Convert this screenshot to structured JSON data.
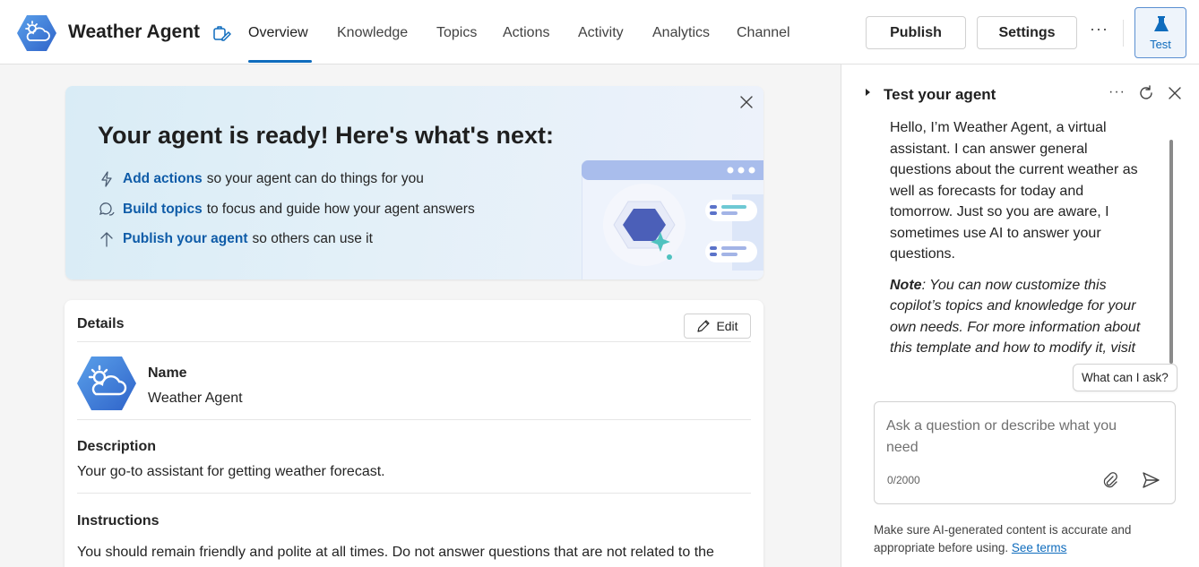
{
  "app": {
    "title": "Weather Agent"
  },
  "nav": {
    "tabs": [
      {
        "label": "Overview",
        "active": true
      },
      {
        "label": "Knowledge"
      },
      {
        "label": "Topics"
      },
      {
        "label": "Actions"
      },
      {
        "label": "Activity"
      },
      {
        "label": "Analytics"
      },
      {
        "label": "Channel"
      }
    ]
  },
  "toolbar": {
    "publish_label": "Publish",
    "settings_label": "Settings",
    "more_label": "···",
    "test_label": "Test"
  },
  "banner": {
    "title": "Your agent is ready! Here's what's next:",
    "items": [
      {
        "icon": "lightning-icon",
        "link": "Add actions",
        "text": "so your agent can do things for you"
      },
      {
        "icon": "chat-bubbles-icon",
        "link": "Build topics",
        "text": "to focus and guide how your agent answers"
      },
      {
        "icon": "arrow-up-icon",
        "link": "Publish your agent",
        "text": "so others can use it"
      }
    ]
  },
  "details": {
    "title": "Details",
    "edit_label": "Edit",
    "name_label": "Name",
    "name_value": "Weather Agent",
    "description_label": "Description",
    "description_value": "Your go-to assistant for getting weather forecast.",
    "instructions_label": "Instructions",
    "instructions_value": "You should remain friendly and polite at all times. Do not answer questions that are not related to the"
  },
  "test_panel": {
    "title": "Test your agent",
    "more_label": "···",
    "greeting": "Hello, I’m Weather Agent, a virtual assistant. I can answer general questions about the current weather as well as forecasts for today and tomorrow. Just so you are aware, I sometimes use AI to answer your questions.",
    "note_label": "Note",
    "note_text": ": You can now customize this copilot’s topics and knowledge for your own needs. For more information about this template and how to modify it, visit the template documentation.",
    "suggestion": "What can I ask?",
    "input_placeholder": "Ask a question or describe what you need",
    "char_count": "0/2000",
    "disclaimer": "Make sure AI-generated content is accurate and appropriate before using.",
    "terms_link": "See terms"
  },
  "colors": {
    "accent": "#0f6cbd",
    "link": "#0f5ca8",
    "logo_hex": "#3f7fd6"
  }
}
